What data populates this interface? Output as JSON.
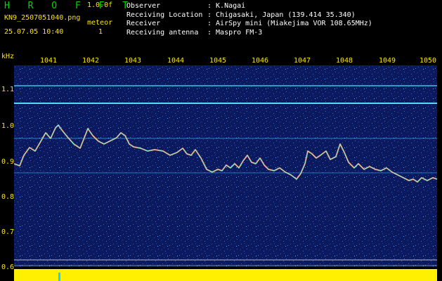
{
  "header": {
    "brand": "H R O F F T",
    "version": "1.0.0f",
    "filename": "KN9_2507051040.png",
    "mode_label": "meteor",
    "count": "1",
    "datetime": "25.07.05 10:40"
  },
  "info": [
    {
      "key": "Observer",
      "value": ": K.Nagai"
    },
    {
      "key": "Receiving Location",
      "value": ": Chigasaki, Japan (139.414 35.340)"
    },
    {
      "key": "Receiver",
      "value": ": AirSpy mini (Miakejima VOR 108.65MHz)"
    },
    {
      "key": "Receiving antenna",
      "value": ": Maspro FM-3"
    }
  ],
  "axis": {
    "y_unit": "kHz",
    "x_ticks": [
      "1041",
      "1042",
      "1043",
      "1044",
      "1045",
      "1046",
      "1047",
      "1048",
      "1049",
      "1050"
    ],
    "y_ticks": [
      "1.1",
      "1.0",
      "0.9",
      "0.8",
      "0.7",
      "0.6"
    ]
  },
  "colors": {
    "background": "#000000",
    "label": "#ffe600",
    "brand": "#00d800",
    "noise_floor": "#0b1a5e",
    "baseline": "#ffef00",
    "cursor": "#19d3ff"
  }
}
